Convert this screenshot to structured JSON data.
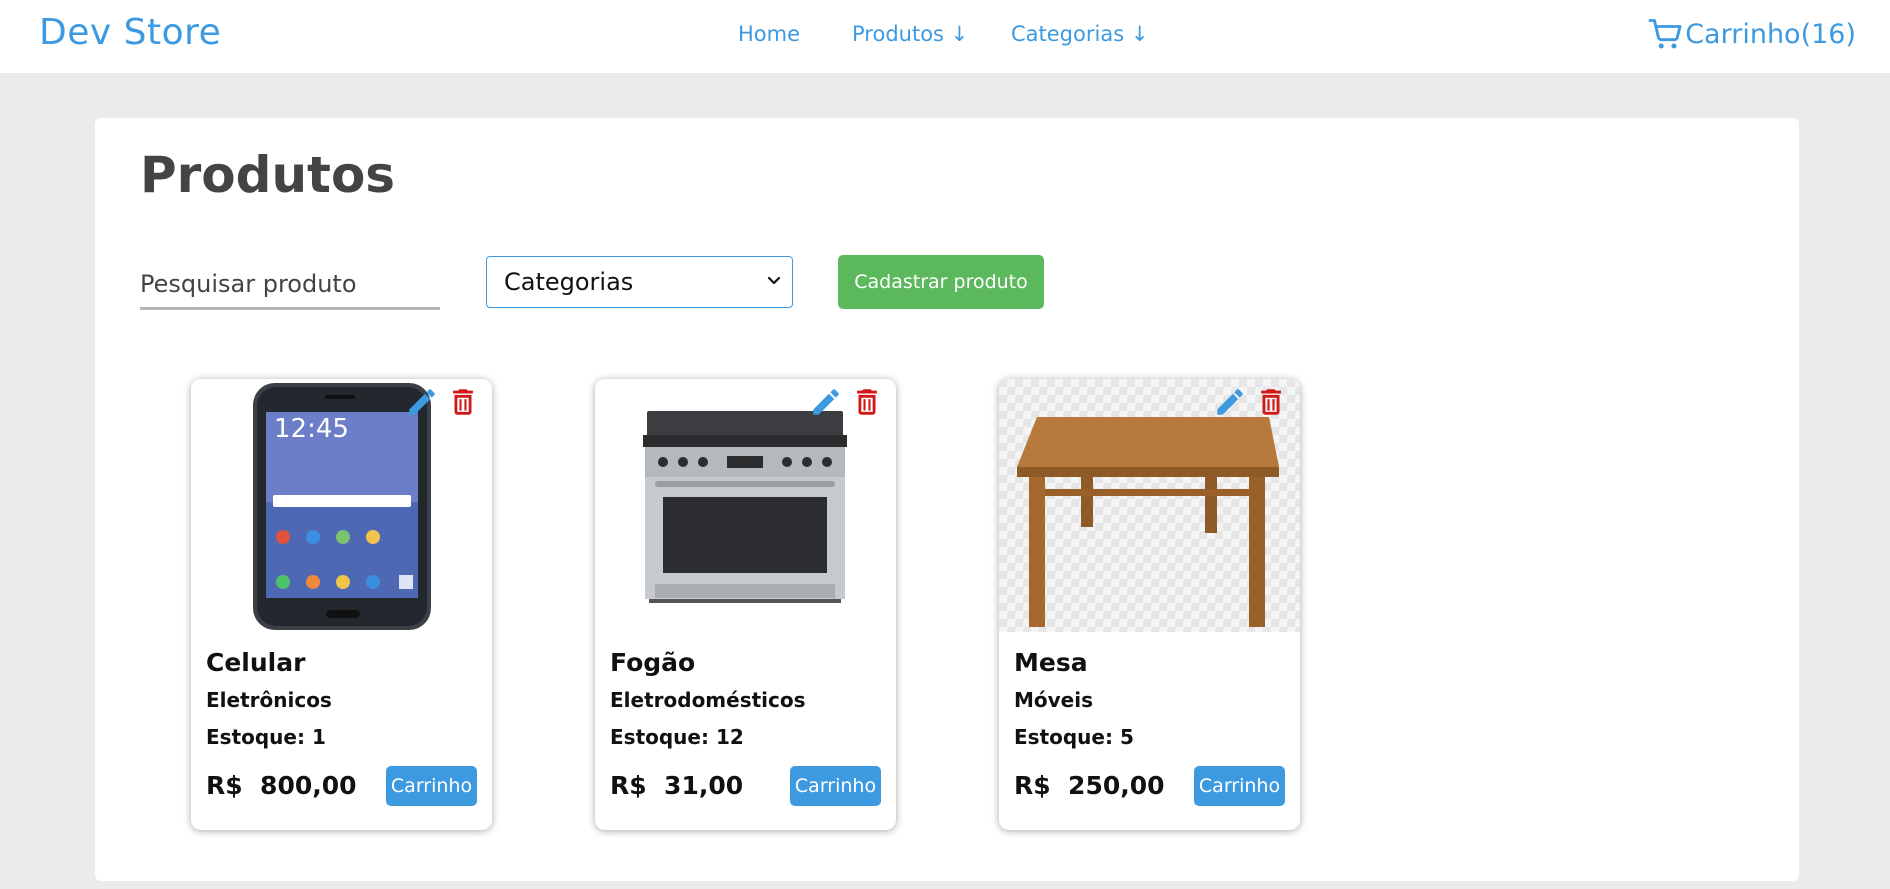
{
  "header": {
    "brand": "Dev Store",
    "nav": [
      {
        "label": "Home"
      },
      {
        "label": "Produtos ↓"
      },
      {
        "label": "Categorias ↓"
      }
    ],
    "cart_label": "Carrinho(16)",
    "cart_icon": "cart-icon"
  },
  "colors": {
    "accent": "#3d9ae0",
    "success": "#5cb85c",
    "danger": "#d01919",
    "background": "#ebebeb"
  },
  "main": {
    "title": "Produtos",
    "search": {
      "placeholder": "Pesquisar produto",
      "value": ""
    },
    "category_select": {
      "selected": "Categorias"
    },
    "add_button": "Cadastrar produto",
    "products": [
      {
        "name": "Celular",
        "category": "Eletrônicos",
        "stock": "Estoque: 1",
        "price": "R$  800,00",
        "cart_button": "Carrinho",
        "image": "smartphone"
      },
      {
        "name": "Fogão",
        "category": "Eletrodomésticos",
        "stock": "Estoque: 12",
        "price": "R$  31,00",
        "cart_button": "Carrinho",
        "image": "stove"
      },
      {
        "name": "Mesa",
        "category": "Móveis",
        "stock": "Estoque: 5",
        "price": "R$  250,00",
        "cart_button": "Carrinho",
        "image": "table"
      }
    ]
  }
}
